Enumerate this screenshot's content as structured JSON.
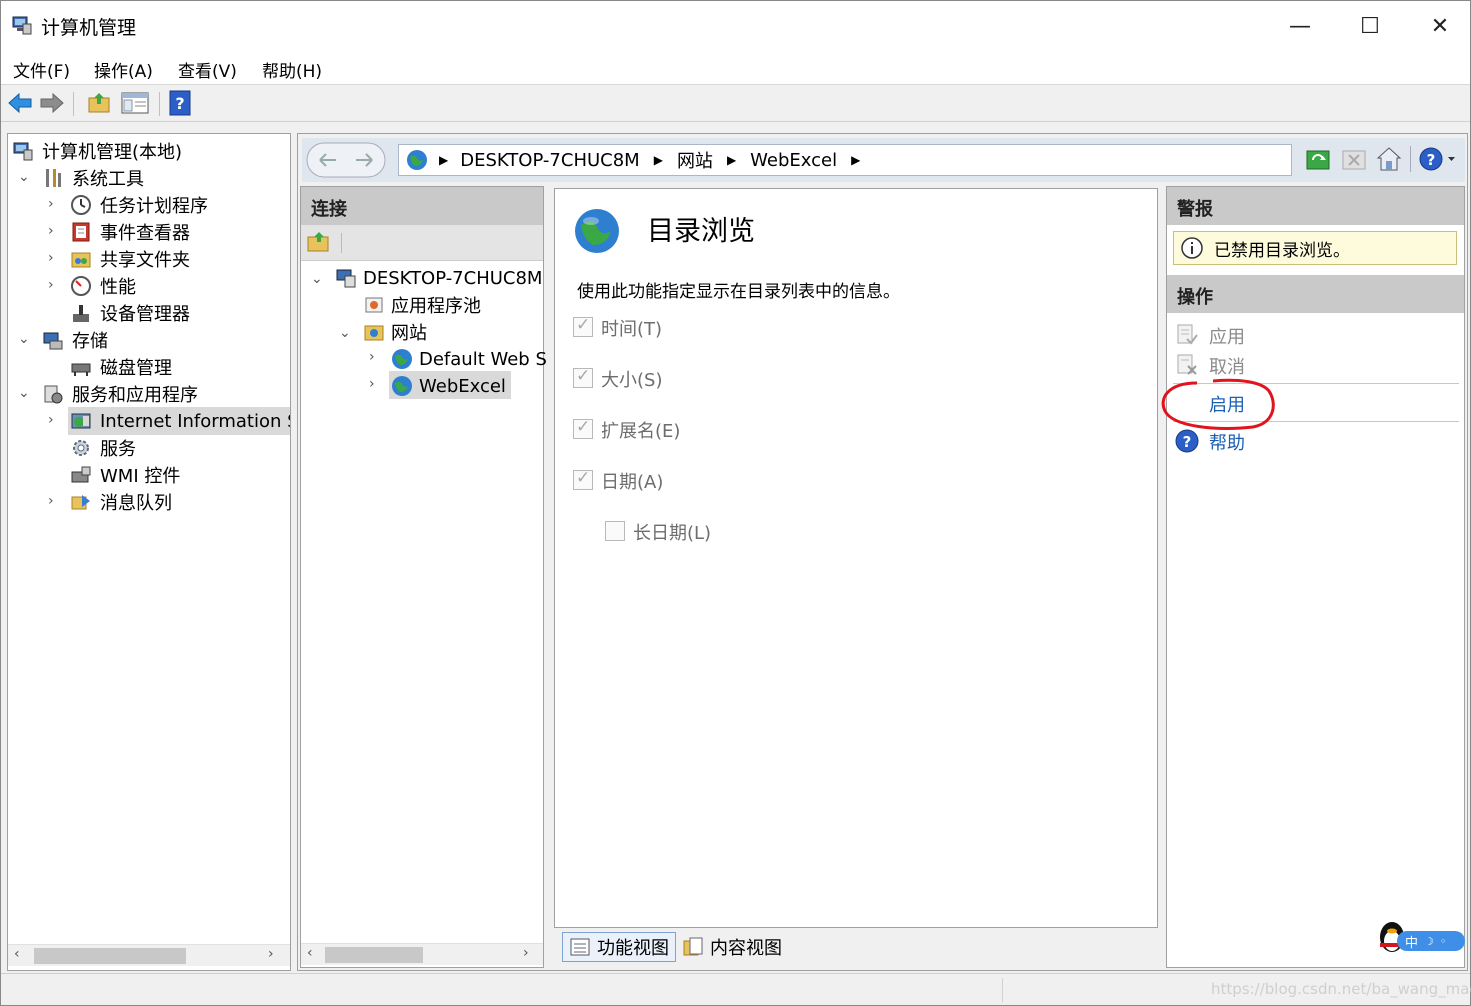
{
  "window": {
    "title": "计算机管理",
    "controls": {
      "minimize": "—",
      "maximize": "☐",
      "close": "✕"
    }
  },
  "menu": [
    "文件(F)",
    "操作(A)",
    "查看(V)",
    "帮助(H)"
  ],
  "tree": {
    "root": "计算机管理(本地)",
    "items": [
      "系统工具",
      "任务计划程序",
      "事件查看器",
      "共享文件夹",
      "性能",
      "设备管理器",
      "存储",
      "磁盘管理",
      "服务和应用程序",
      "Internet Information Se",
      "服务",
      "WMI 控件",
      "消息队列"
    ]
  },
  "address": {
    "crumbs": [
      "DESKTOP-7CHUC8M",
      "网站",
      "WebExcel"
    ]
  },
  "connections": {
    "header": "连接",
    "items": [
      "DESKTOP-7CHUC8M",
      "应用程序池",
      "网站",
      "Default Web S",
      "WebExcel"
    ]
  },
  "feature": {
    "title": "目录浏览",
    "description": "使用此功能指定显示在目录列表中的信息。",
    "options": [
      {
        "label": "时间(T)",
        "checked": true
      },
      {
        "label": "大小(S)",
        "checked": true
      },
      {
        "label": "扩展名(E)",
        "checked": true
      },
      {
        "label": "日期(A)",
        "checked": true
      },
      {
        "label": "长日期(L)",
        "checked": false
      }
    ]
  },
  "view_tabs": [
    "功能视图",
    "内容视图"
  ],
  "actions": {
    "alerts_header": "警报",
    "alert_text": "已禁用目录浏览。",
    "actions_header": "操作",
    "apply": "应用",
    "cancel": "取消",
    "enable": "启用",
    "help": "帮助"
  },
  "ime": "中",
  "watermark": "https://blog.csdn.net/ba_wang_mao",
  "colors": {
    "link": "#1a5fb4",
    "disabled": "#8a8a8a",
    "annotation": "#e0141e",
    "alert_bg": "#fdfbdc"
  }
}
